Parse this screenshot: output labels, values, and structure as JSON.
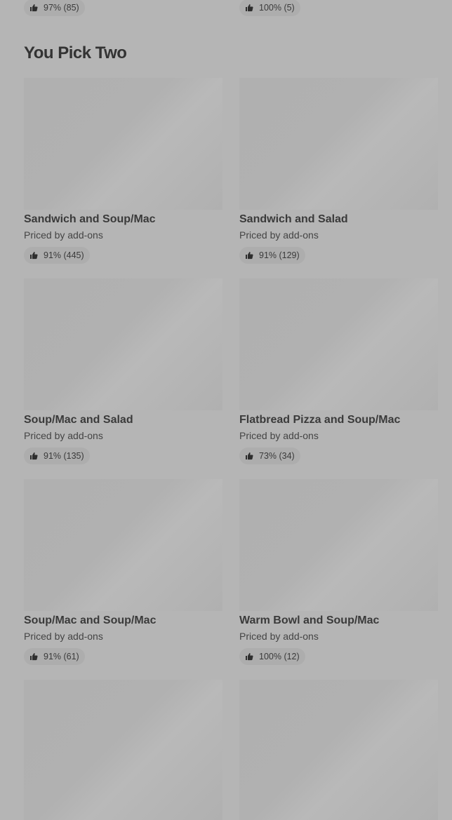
{
  "top_row": [
    {
      "rating": "97% (85)"
    },
    {
      "rating": "100% (5)"
    }
  ],
  "section": {
    "title": "You Pick Two",
    "items": [
      {
        "name": "Sandwich and Soup/Mac",
        "price": "Priced by add-ons",
        "rating": "91% (445)"
      },
      {
        "name": "Sandwich and Salad",
        "price": "Priced by add-ons",
        "rating": "91% (129)"
      },
      {
        "name": "Soup/Mac and Salad",
        "price": "Priced by add-ons",
        "rating": "91% (135)"
      },
      {
        "name": "Flatbread Pizza and Soup/Mac",
        "price": "Priced by add-ons",
        "rating": "73% (34)"
      },
      {
        "name": "Soup/Mac and Soup/Mac",
        "price": "Priced by add-ons",
        "rating": "91% (61)"
      },
      {
        "name": "Warm Bowl and Soup/Mac",
        "price": "Priced by add-ons",
        "rating": "100% (12)"
      }
    ]
  },
  "icons": {
    "rating": "thumbs-up-icon"
  },
  "colors": {
    "background": "#b5b5b5",
    "badge": "#adadad",
    "image_placeholder": "#b0b0b0"
  }
}
